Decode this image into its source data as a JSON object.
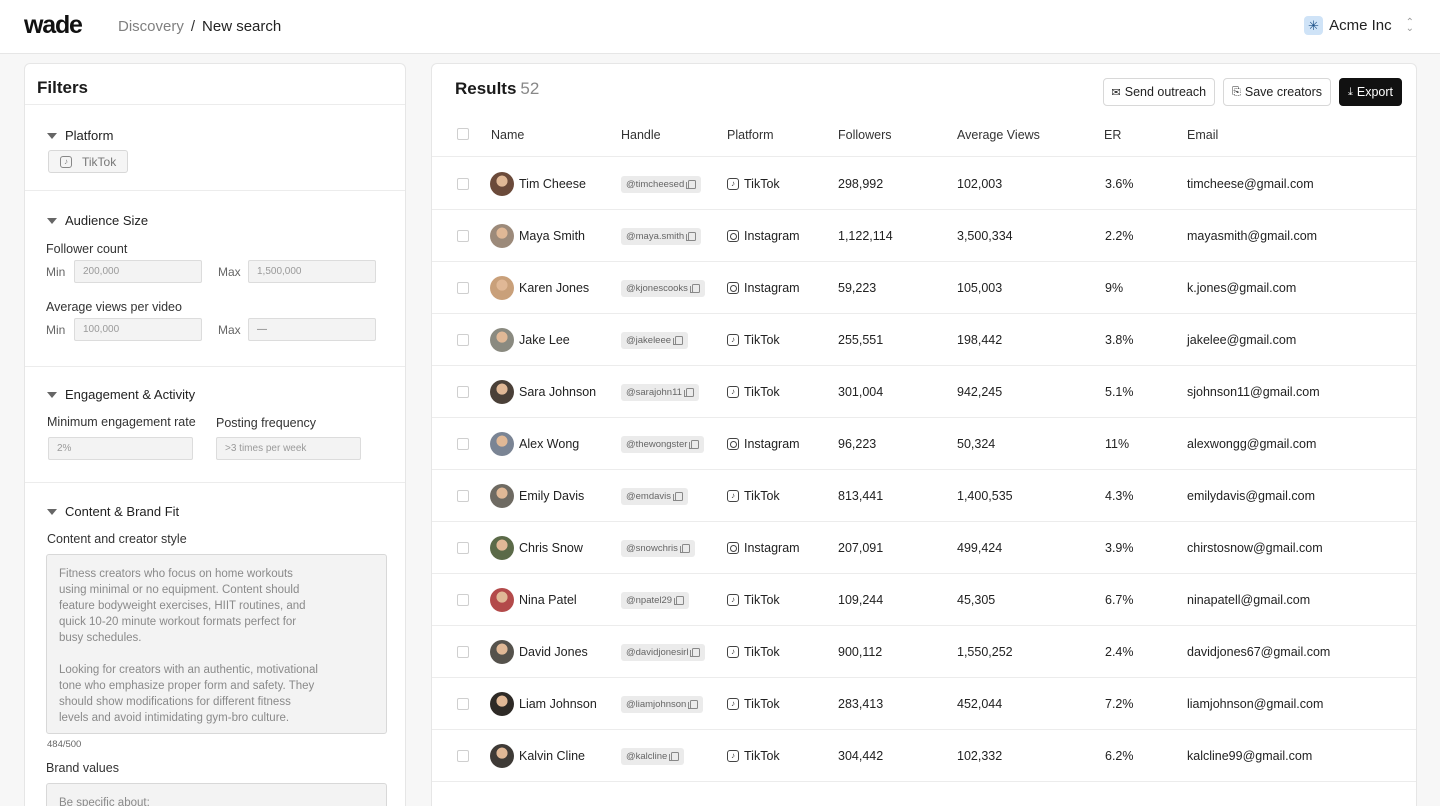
{
  "header": {
    "logo": "wade",
    "breadcrumb": [
      "Discovery",
      "/",
      "New search"
    ],
    "org_name": "Acme Inc"
  },
  "filters": {
    "title": "Filters",
    "platform": {
      "title": "Platform",
      "chip": "TikTok"
    },
    "audience": {
      "title": "Audience Size",
      "follower_label": "Follower count",
      "min_label": "Min",
      "max_label": "Max",
      "follower_min": "200,000",
      "follower_max": "1,500,000",
      "views_label": "Average views per video",
      "views_min": "100,000",
      "views_max": "—"
    },
    "engagement": {
      "title": "Engagement & Activity",
      "min_er_label": "Minimum engagement rate",
      "min_er_value": "2%",
      "freq_label": "Posting frequency",
      "freq_value": ">3 times per week"
    },
    "content": {
      "title": "Content & Brand Fit",
      "style_label": "Content and creator style",
      "style_text_1": "Fitness creators who focus on home workouts\nusing minimal or no  equipment. Content should\nfeature bodyweight exercises, HIIT routines,  and\nquick 10-20 minute workout formats perfect for\nbusy schedules.",
      "style_text_2": "Looking for creators with an authentic, motivational\ntone who emphasize  proper form and safety. They\nshould show modifications for different  fitness\nlevels and avoid intimidating gym-bro culture.",
      "counter": "484/500",
      "brand_label": "Brand values",
      "brand_placeholder": "Be specific about:"
    }
  },
  "results": {
    "title": "Results",
    "count": "52",
    "actions": {
      "outreach": "Send outreach",
      "save": "Save creators",
      "export": "Export"
    },
    "columns": [
      "Name",
      "Handle",
      "Platform",
      "Followers",
      "Average Views",
      "ER",
      "Email"
    ],
    "rows": [
      {
        "name": "Tim Cheese",
        "handle": "@timcheesed",
        "platform": "TikTok",
        "followers": "298,992",
        "views": "102,003",
        "er": "3.6%",
        "email": "timcheese@gmail.com",
        "avatar": "#6b4a3a"
      },
      {
        "name": "Maya Smith",
        "handle": "@maya.smith",
        "platform": "Instagram",
        "followers": "1,122,114",
        "views": "3,500,334",
        "er": "2.2%",
        "email": "mayasmith@gmail.com",
        "avatar": "#9c8a7a"
      },
      {
        "name": "Karen Jones",
        "handle": "@kjonescooks",
        "platform": "Instagram",
        "followers": "59,223",
        "views": "105,003",
        "er": "9%",
        "email": "k.jones@gmail.com",
        "avatar": "#c9a07a"
      },
      {
        "name": "Jake Lee",
        "handle": "@jakeleee",
        "platform": "TikTok",
        "followers": "255,551",
        "views": "198,442",
        "er": "3.8%",
        "email": "jakelee@gmail.com",
        "avatar": "#8a8a80"
      },
      {
        "name": "Sara Johnson",
        "handle": "@sarajohn11",
        "platform": "TikTok",
        "followers": "301,004",
        "views": "942,245",
        "er": "5.1%",
        "email": "sjohnson11@gmail.com",
        "avatar": "#4a4038"
      },
      {
        "name": "Alex Wong",
        "handle": "@thewongster",
        "platform": "Instagram",
        "followers": "96,223",
        "views": "50,324",
        "er": "11%",
        "email": "alexwongg@gmail.com",
        "avatar": "#7a8494"
      },
      {
        "name": "Emily Davis",
        "handle": "@emdavis",
        "platform": "TikTok",
        "followers": "813,441",
        "views": "1,400,535",
        "er": "4.3%",
        "email": "emilydavis@gmail.com",
        "avatar": "#6e6a62"
      },
      {
        "name": "Chris Snow",
        "handle": "@snowchris",
        "platform": "Instagram",
        "followers": "207,091",
        "views": "499,424",
        "er": "3.9%",
        "email": "chirstosnow@gmail.com",
        "avatar": "#5b6a48"
      },
      {
        "name": "Nina Patel",
        "handle": "@npatel29",
        "platform": "TikTok",
        "followers": "109,244",
        "views": "45,305",
        "er": "6.7%",
        "email": "ninapatell@gmail.com",
        "avatar": "#b34a4a"
      },
      {
        "name": "David Jones",
        "handle": "@davidjonesirl",
        "platform": "TikTok",
        "followers": "900,112",
        "views": "1,550,252",
        "er": "2.4%",
        "email": "davidjones67@gmail.com",
        "avatar": "#55524c"
      },
      {
        "name": "Liam Johnson",
        "handle": "@liamjohnson",
        "platform": "TikTok",
        "followers": "283,413",
        "views": "452,044",
        "er": "7.2%",
        "email": "liamjohnson@gmail.com",
        "avatar": "#2e2a26"
      },
      {
        "name": "Kalvin Cline",
        "handle": "@kalcline",
        "platform": "TikTok",
        "followers": "304,442",
        "views": "102,332",
        "er": "6.2%",
        "email": "kalcline99@gmail.com",
        "avatar": "#3e3a36"
      }
    ]
  }
}
